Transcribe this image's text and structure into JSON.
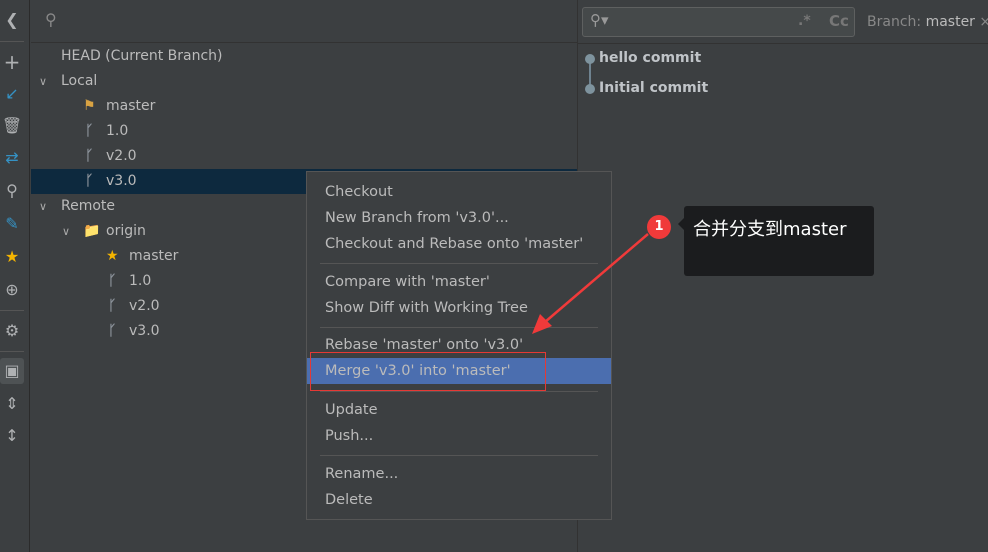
{
  "toolbar": {
    "icons": [
      "back-icon",
      "plus-icon",
      "update-icon",
      "delete-icon",
      "compare-icon",
      "search-icon",
      "edit-icon",
      "favorite-star-icon",
      "locate-icon",
      "settings-icon",
      "group-icon",
      "expand-all-icon",
      "collapse-all-icon"
    ]
  },
  "tree": {
    "head": "HEAD (Current Branch)",
    "local_label": "Local",
    "local": [
      "master",
      "1.0",
      "v2.0",
      "v3.0"
    ],
    "remote_label": "Remote",
    "origin_label": "origin",
    "remote": [
      "master",
      "1.0",
      "v2.0",
      "v3.0"
    ]
  },
  "log": {
    "branch_prefix": "Branch:",
    "branch_value": "master",
    "regex_label": ".*",
    "case_label": "Cc",
    "commits": [
      "hello commit",
      "Initial commit"
    ]
  },
  "menu": {
    "items": [
      "Checkout",
      "New Branch from 'v3.0'...",
      "Checkout and Rebase onto 'master'",
      "Compare with 'master'",
      "Show Diff with Working Tree",
      "Rebase 'master' onto 'v3.0'",
      "Merge 'v3.0' into 'master'",
      "Update",
      "Push...",
      "Rename...",
      "Delete"
    ],
    "selected": "Merge 'v3.0' into 'master'"
  },
  "annotation": {
    "number": "1",
    "text": "合并分支到master",
    "color": "#f03a3a"
  },
  "colors": {
    "selection": "#0d293e",
    "menu_highlight": "#4b6eaf",
    "tag": "#d9a343",
    "star": "#f4b400"
  }
}
